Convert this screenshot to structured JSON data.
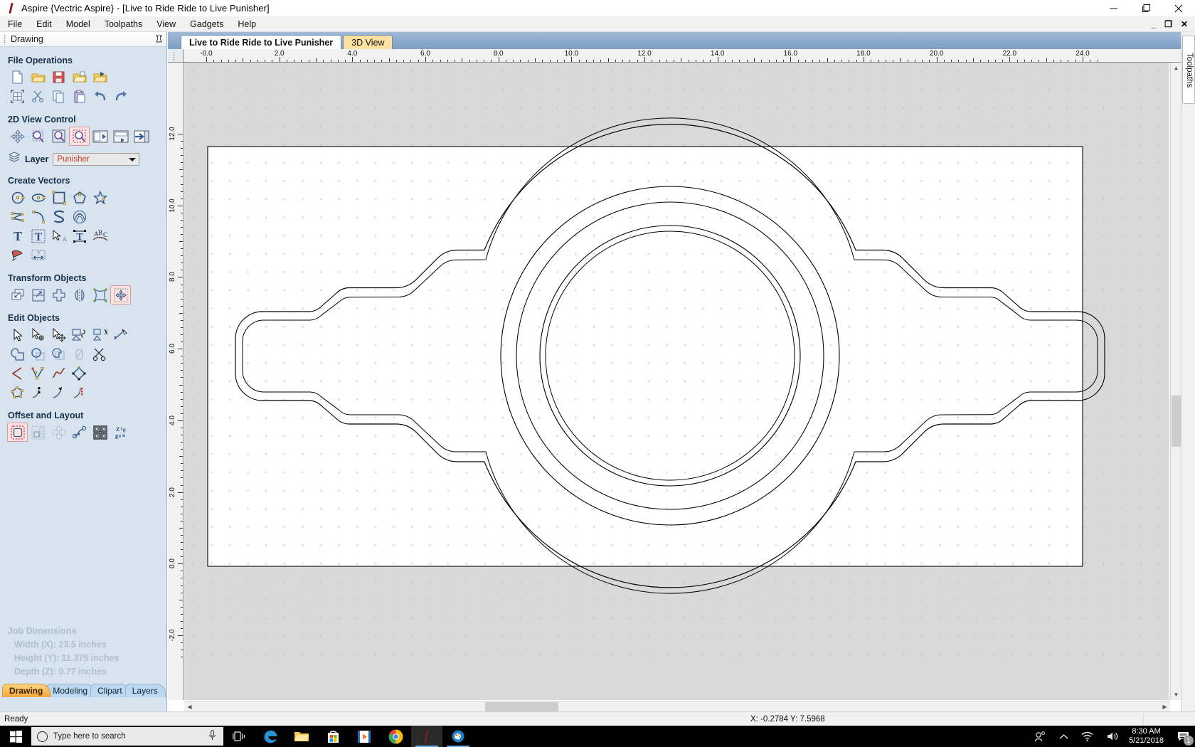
{
  "window": {
    "title": "Aspire {Vectric Aspire} - [Live to Ride Ride to Live Punisher]",
    "app_icon": "vectric-logo-icon",
    "minimize": "minimize-icon",
    "maximize": "maximize-icon",
    "close": "close-icon",
    "mdi_minimize": "_",
    "mdi_restore": "❐",
    "mdi_close": "✕"
  },
  "menu": {
    "items": [
      "File",
      "Edit",
      "Model",
      "Toolpaths",
      "View",
      "Gadgets",
      "Help"
    ]
  },
  "left_panel": {
    "header_title": "Drawing",
    "pin_icon": "pin-icon",
    "sections": [
      {
        "title": "File Operations",
        "rows": [
          [
            "new-file-icon",
            "open-folder-icon",
            "save-icon",
            "open-recent-icon",
            "import-icon"
          ],
          [
            "select-all-icon",
            "cut-icon",
            "copy-icon",
            "paste-icon",
            "undo-icon",
            "redo-icon"
          ]
        ]
      },
      {
        "title": "2D View Control",
        "rows": [
          [
            "pan-icon",
            "zoom-window-icon",
            "zoom-selected-icon",
            "zoom-box-icon",
            "zoom-drawing-icon",
            "zoom-extents-icon",
            "view-toggle-icon"
          ]
        ]
      },
      {
        "title": "Create Vectors",
        "rows": [
          [
            "circle-icon",
            "ellipse-icon",
            "rectangle-icon",
            "polygon-icon",
            "star-icon"
          ],
          [
            "polyline-icon",
            "arc-icon",
            "curve-icon",
            "spiral-icon"
          ],
          [
            "text-icon",
            "text-box-icon",
            "text-select-icon",
            "text-transform-icon",
            "text-on-curve-icon"
          ],
          [
            "trace-bitmap-icon",
            "dimension-icon"
          ]
        ]
      },
      {
        "title": "Transform Objects",
        "rows": [
          [
            "move-icon",
            "scale-icon",
            "rotate-icon",
            "mirror-icon",
            "distort-icon",
            "align-icon"
          ]
        ]
      },
      {
        "title": "Edit Objects",
        "rows": [
          [
            "select-arrow-icon",
            "node-edit-icon",
            "move-nodes-icon",
            "join-vectors-icon",
            "close-vector-icon",
            "measure-icon"
          ],
          [
            "weld-icon",
            "subtract-icon",
            "intersect-icon",
            "fill-icon",
            "trim-icon"
          ],
          [
            "fillet-icon",
            "node-tools-icon",
            "smooth-curve-icon",
            "shape-nodes-icon"
          ],
          [
            "point-editor-icon",
            "start-node-icon",
            "reverse-direction-icon",
            "split-node-icon"
          ]
        ]
      },
      {
        "title": "Offset and Layout",
        "rows": [
          [
            "offset-icon",
            "array-copy-icon",
            "circular-copy-icon",
            "copy-along-curve-icon",
            "nesting-icon",
            "text-wrap-icon"
          ]
        ]
      }
    ],
    "layer": {
      "label": "Layer",
      "icon": "layers-icon",
      "value": "Punisher",
      "options": [
        "Punisher"
      ]
    },
    "job_dimensions": {
      "title": "Job Dimensions",
      "width": "Width  (X): 23.5 inches",
      "height": "Height (Y): 11.375 inches",
      "depth": "Depth  (Z): 0.77 inches"
    },
    "tabs": [
      {
        "label": "Drawing",
        "active": true
      },
      {
        "label": "Modeling",
        "active": false
      },
      {
        "label": "Clipart",
        "active": false
      },
      {
        "label": "Layers",
        "active": false
      }
    ]
  },
  "document_tabs": [
    {
      "label": "Live to Ride Ride to Live Punisher",
      "active": true
    },
    {
      "label": "3D View",
      "active": false
    }
  ],
  "rulers": {
    "horizontal_labels": [
      "-0.0",
      "2.0",
      "4.0",
      "6.0",
      "8.0",
      "10.0",
      "12.0",
      "14.0",
      "16.0",
      "18.0",
      "20.0",
      "22.0",
      "24.0"
    ],
    "vertical_labels": [
      "12.0",
      "10.0",
      "8.0",
      "6.0",
      "4.0",
      "2.0",
      "0.0",
      "-2.0"
    ]
  },
  "canvas": {
    "material_fill": "#ffffff",
    "background": "#d9d9d9",
    "vector_color": "#000000",
    "grid_dot_color": "#c8c8c8"
  },
  "right_dock": {
    "tab_label": "Toolpaths"
  },
  "status_bar": {
    "message": "Ready",
    "coordinates": "X: -0.2784 Y:  7.5968"
  },
  "taskbar": {
    "start_icon": "windows-start-icon",
    "search_placeholder": "Type here to search",
    "cortana_icon": "cortana-circle-icon",
    "mic_icon": "microphone-icon",
    "buttons": [
      {
        "name": "task-view-icon",
        "label": ""
      },
      {
        "name": "edge-icon",
        "label": ""
      },
      {
        "name": "file-explorer-icon",
        "label": ""
      },
      {
        "name": "microsoft-store-icon",
        "label": ""
      },
      {
        "name": "media-player-icon",
        "label": ""
      },
      {
        "name": "chrome-icon",
        "label": ""
      },
      {
        "name": "vectric-aspire-icon",
        "label": ""
      },
      {
        "name": "paint-icon",
        "label": ""
      }
    ],
    "tray": {
      "people_icon": "people-icon",
      "chevron_icon": "chevron-up-icon",
      "wifi_icon": "wifi-icon",
      "volume_icon": "volume-icon"
    },
    "clock_time": "8:30 AM",
    "clock_date": "5/21/2018",
    "notification_icon": "notification-icon",
    "notification_count": "1"
  },
  "colors": {
    "panel_bg": "#d7e3ef",
    "accent_tab": "#f3a93c",
    "layer_text": "#c0392b",
    "titlebar_bg": "#ffffff"
  }
}
